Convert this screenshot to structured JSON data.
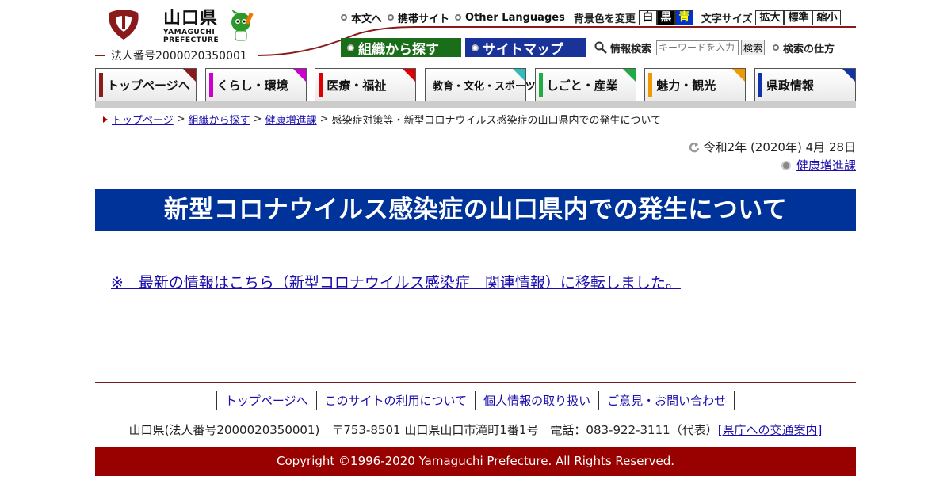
{
  "header": {
    "logo_name_ja": "山口県",
    "logo_name_en_1": "YAMAGUCHI",
    "logo_name_en_2": "PREFECTURE",
    "corporate_number": "法人番号2000020350001",
    "top_links": {
      "honbun": "本文へ",
      "mobile": "携帯サイト",
      "languages": "Other Languages"
    },
    "bg_color_label": "背景色を変更",
    "bg_options": [
      "白",
      "黒",
      "青"
    ],
    "font_size_label": "文字サイズ",
    "font_size_options": [
      "拡大",
      "標準",
      "縮小"
    ],
    "btn_soshiki": "組織から探す",
    "btn_sitemap": "サイトマップ",
    "search_label": "情報検索",
    "search_placeholder": "キーワードを入力",
    "search_button": "検索",
    "search_howto": "検索の仕方"
  },
  "nav": [
    {
      "label": "トップページへ",
      "color": "#8b1a1a"
    },
    {
      "label": "くらし・環境",
      "color": "#cc00cc"
    },
    {
      "label": "医療・福祉",
      "color": "#dd0000"
    },
    {
      "label": "教育・文化・スポーツ",
      "color": "#33bbbb"
    },
    {
      "label": "しごと・産業",
      "color": "#22aa44"
    },
    {
      "label": "魅力・観光",
      "color": "#ee9900"
    },
    {
      "label": "県政情報",
      "color": "#1133aa"
    }
  ],
  "breadcrumb": {
    "top": "トップページ",
    "soshiki": "組織から探す",
    "dept": "健康増進課",
    "current": "感染症対策等・新型コロナウイルス感染症の山口県内での発生について",
    "separator": ">"
  },
  "meta": {
    "date": "令和2年 (2020年) 4月 28日",
    "department": "健康増進課"
  },
  "page": {
    "title": "新型コロナウイルス感染症の山口県内での発生について",
    "notice": "※　最新の情報はこちら（新型コロナウイルス感染症　関連情報）に移転しました。"
  },
  "footer": {
    "links": [
      "トップページへ",
      "このサイトの利用について",
      "個人情報の取り扱い",
      "ご意見・お問い合わせ"
    ],
    "address": "山口県(法人番号2000020350001)　〒753-8501 山口県山口市滝町1番1号　電話：083-922-3111（代表）",
    "access_link": "[県庁への交通案内]",
    "copyright": "Copyright ©1996-2020 Yamaguchi Prefecture. All Rights Reserved."
  },
  "colors": {
    "title_bg": "#003399",
    "copyright_bg": "#990000",
    "accent_line": "#7a1a1a",
    "link": "#1a0dab"
  }
}
